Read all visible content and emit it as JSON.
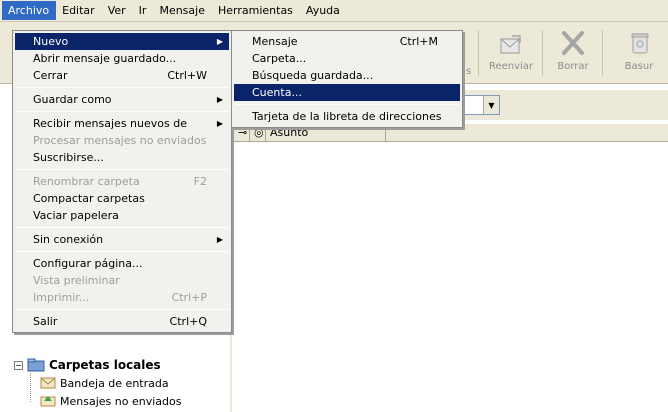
{
  "menubar": {
    "items": [
      {
        "label": "Archivo",
        "u": "A"
      },
      {
        "label": "Editar",
        "u": "E"
      },
      {
        "label": "Ver",
        "u": "V"
      },
      {
        "label": "Ir",
        "u": "I"
      },
      {
        "label": "Mensaje",
        "u": "M"
      },
      {
        "label": "Herramientas",
        "u": "t"
      },
      {
        "label": "Ayuda",
        "u": "u"
      }
    ]
  },
  "file_menu": {
    "items": [
      {
        "label": "Nuevo",
        "has_submenu": true,
        "highlighted": true
      },
      {
        "label": "Abrir mensaje guardado..."
      },
      {
        "label": "Cerrar",
        "shortcut": "Ctrl+W"
      },
      {
        "separator": true
      },
      {
        "label": "Guardar como",
        "has_submenu": true
      },
      {
        "separator": true
      },
      {
        "label": "Recibir mensajes nuevos de",
        "has_submenu": true
      },
      {
        "label": "Procesar mensajes no enviados",
        "disabled": true
      },
      {
        "label": "Suscribirse..."
      },
      {
        "separator": true
      },
      {
        "label": "Renombrar carpeta",
        "shortcut": "F2",
        "disabled": true
      },
      {
        "label": "Compactar carpetas"
      },
      {
        "label": "Vaciar papelera"
      },
      {
        "separator": true
      },
      {
        "label": "Sin conexión",
        "has_submenu": true
      },
      {
        "separator": true
      },
      {
        "label": "Configurar página..."
      },
      {
        "label": "Vista preliminar",
        "disabled": true
      },
      {
        "label": "Imprimir...",
        "shortcut": "Ctrl+P",
        "disabled": true
      },
      {
        "separator": true
      },
      {
        "label": "Salir",
        "shortcut": "Ctrl+Q"
      }
    ]
  },
  "new_submenu": {
    "items": [
      {
        "label": "Mensaje",
        "shortcut": "Ctrl+M"
      },
      {
        "label": "Carpeta..."
      },
      {
        "label": "Búsqueda guardada..."
      },
      {
        "label": "Cuenta...",
        "highlighted": true
      },
      {
        "separator": true
      },
      {
        "label": "Tarjeta de la libreta de direcciones"
      }
    ]
  },
  "toolbar": {
    "partial_label": "s",
    "reenviar": "Reenviar",
    "borrar": "Borrar",
    "basura": "Basur"
  },
  "column_header": {
    "asunto": "Asunto"
  },
  "folders": {
    "local": "Carpetas locales",
    "inbox": "Bandeja de entrada",
    "unsent": "Mensajes no enviados"
  }
}
